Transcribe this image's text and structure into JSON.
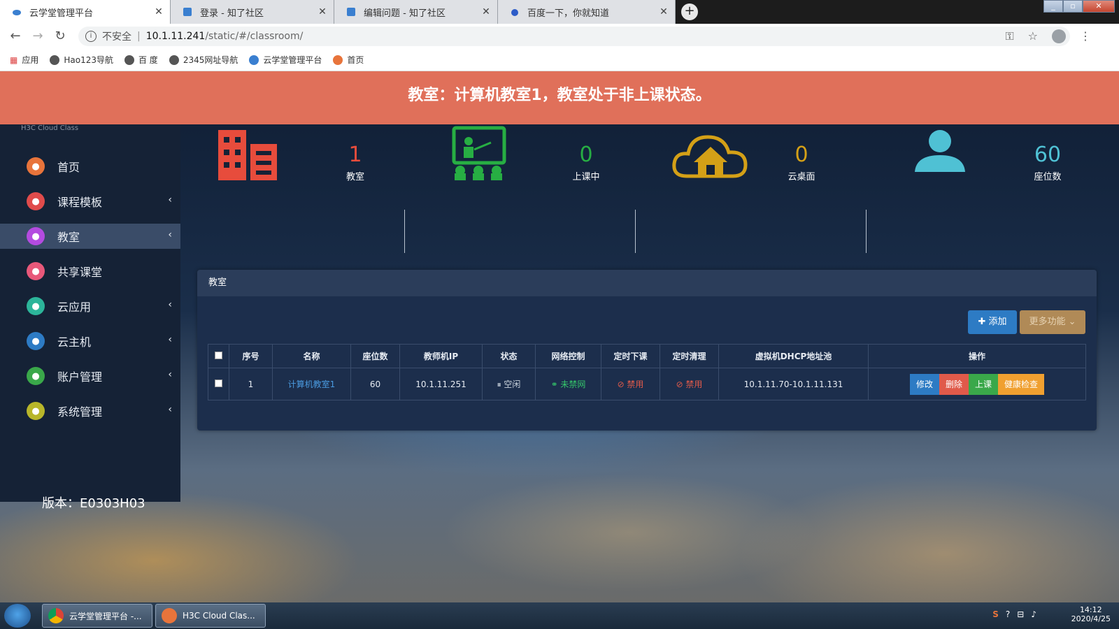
{
  "browser": {
    "tabs": [
      {
        "title": "云学堂管理平台",
        "active": true
      },
      {
        "title": "登录 - 知了社区",
        "active": false
      },
      {
        "title": "编辑问题 - 知了社区",
        "active": false
      },
      {
        "title": "百度一下，你就知道",
        "active": false
      }
    ],
    "new_tab": "+",
    "url_insecure": "不安全",
    "url_host": "10.1.11.241",
    "url_path": "/static/#/classroom/",
    "bookmarks": [
      "应用",
      "Hao123导航",
      "百 度",
      "2345网址导航",
      "云学堂管理平台",
      "首页"
    ]
  },
  "alert": "教室：计算机教室1，教室处于非上课状态。",
  "sidebar": {
    "logo_text": "H3C Cloud Class",
    "items": [
      {
        "label": "首页",
        "icon": "home-icon",
        "color": "#e8743b",
        "chevron": false,
        "active": false
      },
      {
        "label": "课程模板",
        "icon": "template-icon",
        "color": "#e04b4b",
        "chevron": true,
        "active": false
      },
      {
        "label": "教室",
        "icon": "classroom-icon",
        "color": "#b44be0",
        "chevron": true,
        "active": true
      },
      {
        "label": "共享课堂",
        "icon": "share-icon",
        "color": "#e8587a",
        "chevron": false,
        "active": false
      },
      {
        "label": "云应用",
        "icon": "cloud-app-icon",
        "color": "#2cb59a",
        "chevron": true,
        "active": false
      },
      {
        "label": "云主机",
        "icon": "host-icon",
        "color": "#2d7bc4",
        "chevron": true,
        "active": false
      },
      {
        "label": "账户管理",
        "icon": "user-icon",
        "color": "#3aa84a",
        "chevron": true,
        "active": false
      },
      {
        "label": "系统管理",
        "icon": "gear-icon",
        "color": "#b8b62a",
        "chevron": true,
        "active": false
      }
    ],
    "version": "版本：E0303H03"
  },
  "stats": [
    {
      "value": "1",
      "label": "教室",
      "color": "#e74c3c"
    },
    {
      "value": "0",
      "label": "上课中",
      "color": "#27ae43"
    },
    {
      "value": "0",
      "label": "云桌面",
      "color": "#d4a017"
    },
    {
      "value": "60",
      "label": "座位数",
      "color": "#4fc1d4"
    }
  ],
  "panel": {
    "title": "教室",
    "add_button": "✚ 添加",
    "more_button": "更多功能 ⌄",
    "columns": [
      "序号",
      "名称",
      "座位数",
      "教师机IP",
      "状态",
      "网络控制",
      "定时下课",
      "定时清理",
      "虚拟机DHCP地址池",
      "操作"
    ],
    "rows": [
      {
        "index": "1",
        "name": "计算机教室1",
        "seats": "60",
        "teacher_ip": "10.1.11.251",
        "status": "⏸ 空闲",
        "network": "⚭ 未禁网",
        "timed_end": "⊘ 禁用",
        "timed_clean": "⊘ 禁用",
        "dhcp_pool": "10.1.11.70-10.1.11.131",
        "actions": [
          "修改",
          "删除",
          "上课",
          "健康检查"
        ]
      }
    ]
  },
  "taskbar": {
    "items": [
      "云学堂管理平台 -...",
      "H3C Cloud Clas..."
    ],
    "time": "14:12",
    "date": "2020/4/25"
  },
  "colors": {
    "alert_bg": "#e0705a",
    "action_edit": "#2d7bc4",
    "action_delete": "#e05a4a",
    "action_start": "#3aa84a",
    "action_health": "#f0a030"
  }
}
